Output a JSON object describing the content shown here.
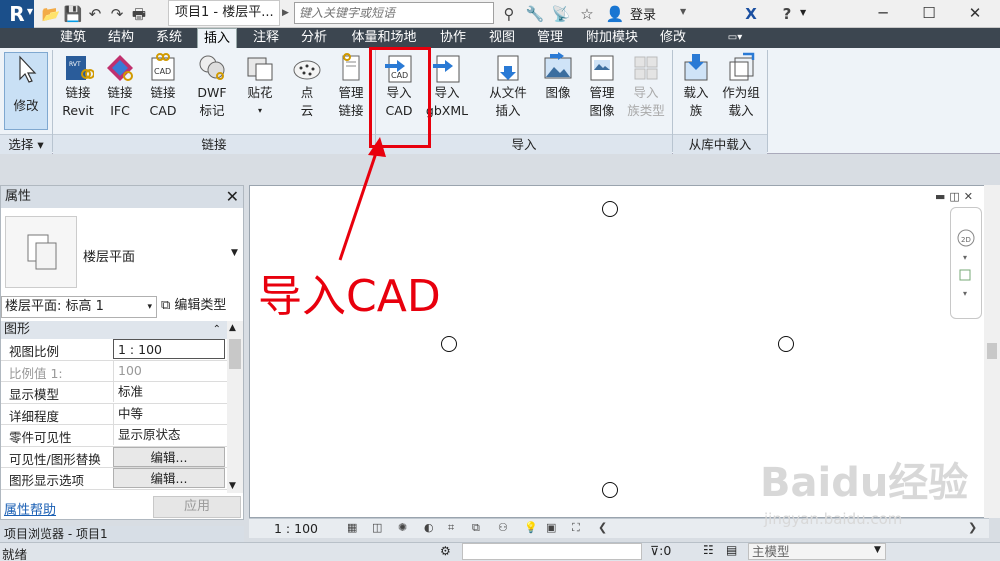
{
  "titlebar": {
    "app_logo": "R",
    "title": "项目1 - 楼层平...",
    "search_placeholder": "键入关键字或短语",
    "login": "登录",
    "help": "?"
  },
  "tabs": [
    "建筑",
    "结构",
    "系统",
    "插入",
    "注释",
    "分析",
    "体量和场地",
    "协作",
    "视图",
    "管理",
    "附加模块",
    "修改"
  ],
  "active_tab": "插入",
  "ribbon": {
    "modify": "修改",
    "buttons": {
      "link_revit": [
        "链接",
        "Revit"
      ],
      "link_ifc": [
        "链接",
        "IFC"
      ],
      "link_cad": [
        "链接",
        "CAD"
      ],
      "dwf": [
        "DWF",
        "标记"
      ],
      "decal": [
        "贴花",
        ""
      ],
      "point_cloud": [
        "点",
        "云"
      ],
      "manage_links": [
        "管理",
        "链接"
      ],
      "import_cad": [
        "导入",
        "CAD"
      ],
      "import_gbxml": [
        "导入",
        "gbXML"
      ],
      "insert_from_file": [
        "从文件",
        "插入"
      ],
      "image": [
        "图像",
        ""
      ],
      "manage_images": [
        "管理",
        "图像"
      ],
      "import_family_types": [
        "导入",
        "族类型"
      ],
      "load_family": [
        "载入",
        "族"
      ],
      "load_as_group": [
        "作为组",
        "载入"
      ]
    },
    "panels": {
      "select": "选择",
      "link": "链接",
      "import": "导入",
      "load_from_library": "从库中载入"
    }
  },
  "annotation": {
    "label": "导入CAD",
    "color": "#e8000d"
  },
  "properties": {
    "header": "属性",
    "type_name": "楼层平面",
    "view_selector": "楼层平面: 标高 1",
    "edit_type": "编辑类型",
    "section": "图形",
    "rows": [
      {
        "key": "视图比例",
        "value": "1 : 100"
      },
      {
        "key": "比例值 1:",
        "value": "100"
      },
      {
        "key": "显示模型",
        "value": "标准"
      },
      {
        "key": "详细程度",
        "value": "中等"
      },
      {
        "key": "零件可见性",
        "value": "显示原状态"
      },
      {
        "key": "可见性/图形替换",
        "value": "编辑..."
      },
      {
        "key": "图形显示选项",
        "value": "编辑..."
      }
    ],
    "help": "属性帮助",
    "apply": "应用"
  },
  "browser": {
    "header": "项目浏览器 - 项目1"
  },
  "viewbar": {
    "scale": "1 : 100"
  },
  "statusbar": {
    "status": "就绪",
    "filter_count": ":0",
    "model": "主模型"
  },
  "watermark": {
    "brand": "Baidu经验",
    "url": "jingyan.baidu.com"
  }
}
